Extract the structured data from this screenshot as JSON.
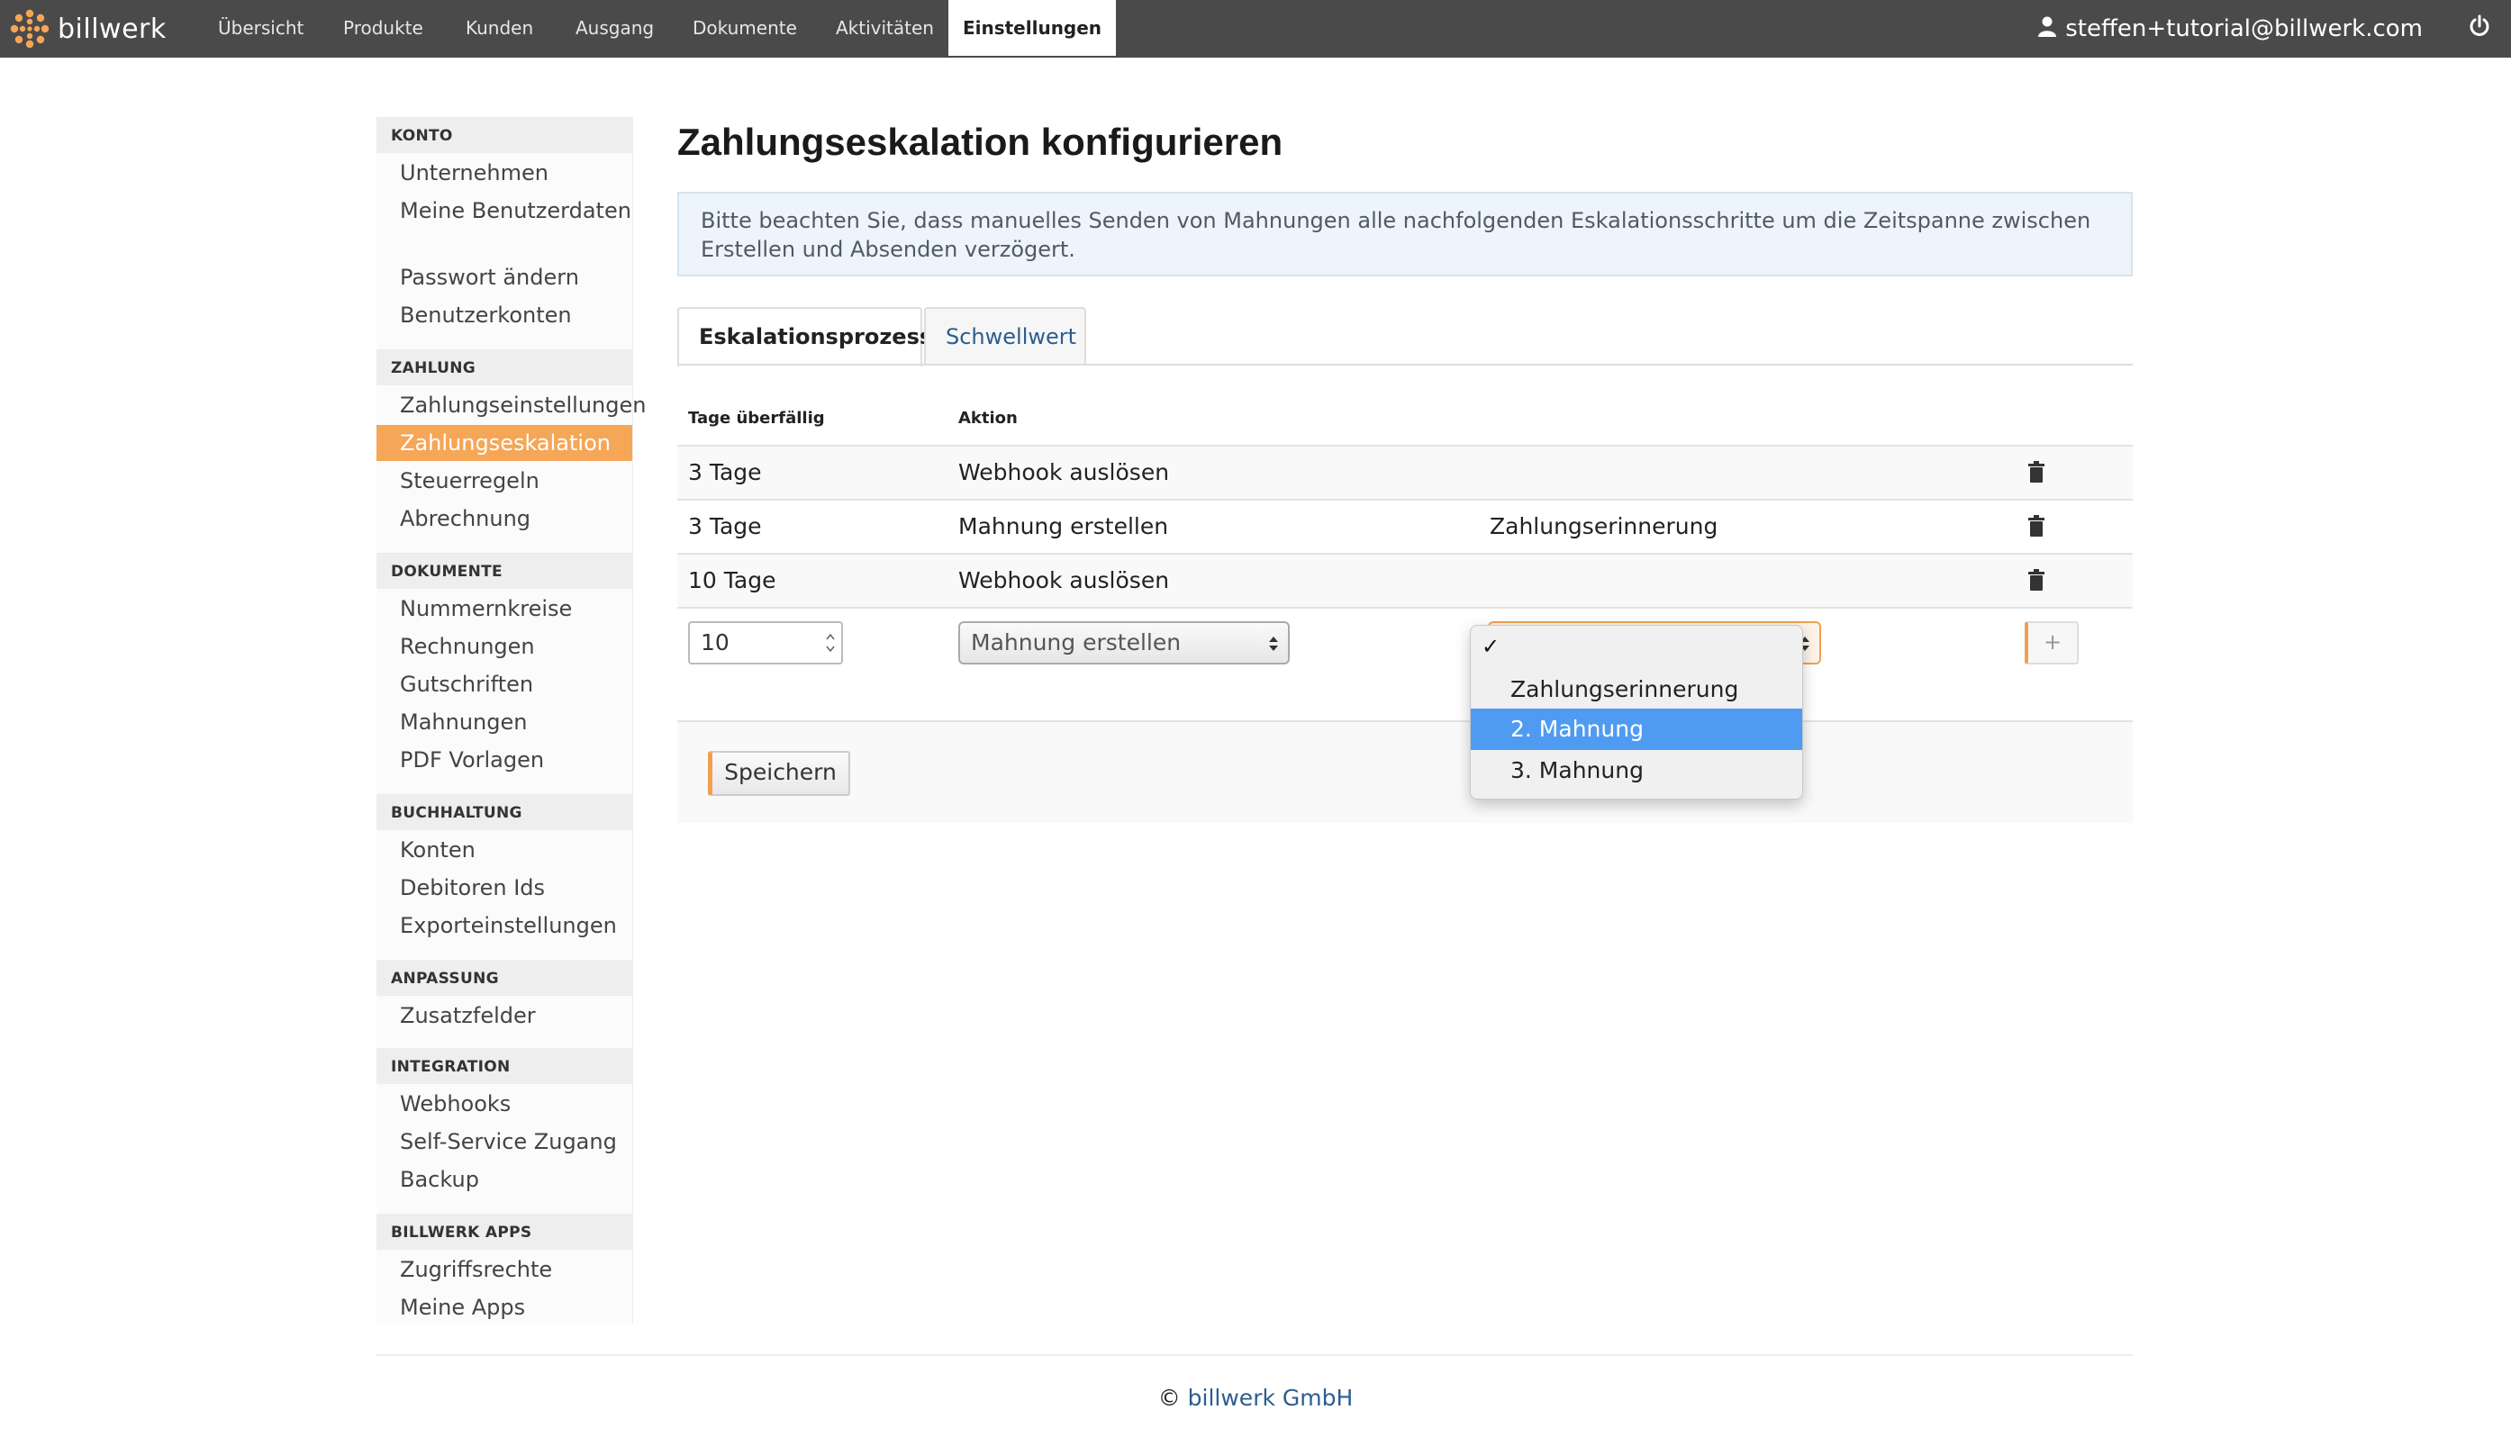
{
  "brand": {
    "name": "billwerk",
    "accent": "#f5a657"
  },
  "nav": {
    "items": [
      {
        "label": "Übersicht"
      },
      {
        "label": "Produkte"
      },
      {
        "label": "Kunden"
      },
      {
        "label": "Ausgang"
      },
      {
        "label": "Dokumente"
      },
      {
        "label": "Aktivitäten"
      },
      {
        "label": "Einstellungen",
        "active": true
      }
    ],
    "user_email": "steffen+tutorial@billwerk.com",
    "user_icon": "user-icon",
    "power_icon": "power-icon"
  },
  "sidebar": {
    "konto": {
      "heading": "KONTO",
      "items": [
        "Unternehmen",
        "Meine Benutzerdaten",
        "Passwort ändern",
        "Benutzerkonten"
      ]
    },
    "zahlung": {
      "heading": "ZAHLUNG",
      "items": [
        "Zahlungseinstellungen",
        "Zahlungseskalation",
        "Steuerregeln",
        "Abrechnung"
      ],
      "active": "Zahlungseskalation"
    },
    "dokumente": {
      "heading": "DOKUMENTE",
      "items": [
        "Nummernkreise",
        "Rechnungen",
        "Gutschriften",
        "Mahnungen",
        "PDF Vorlagen"
      ]
    },
    "buchhaltung": {
      "heading": "BUCHHALTUNG",
      "items": [
        "Konten",
        "Debitoren Ids",
        "Exporteinstellungen"
      ]
    },
    "anpassung": {
      "heading": "ANPASSUNG",
      "items": [
        "Zusatzfelder"
      ]
    },
    "integration": {
      "heading": "INTEGRATION",
      "items": [
        "Webhooks",
        "Self-Service Zugang",
        "Backup"
      ]
    },
    "apps": {
      "heading": "BILLWERK APPS",
      "items": [
        "Zugriffsrechte",
        "Meine Apps"
      ]
    }
  },
  "main": {
    "title": "Zahlungseskalation konfigurieren",
    "info": "Bitte beachten Sie, dass manuelles Senden von Mahnungen alle nachfolgenden Eskalationsschritte um die Zeitspanne zwischen Erstellen und Absenden verzögert.",
    "tabs": [
      {
        "label": "Eskalationsprozess",
        "active": true
      },
      {
        "label": "Schwellwert"
      }
    ],
    "columns": {
      "days": "Tage überfällig",
      "action": "Aktion"
    },
    "rows": [
      {
        "days": "3 Tage",
        "action": "Webhook auslösen",
        "template": ""
      },
      {
        "days": "3 Tage",
        "action": "Mahnung erstellen",
        "template": "Zahlungserinnerung"
      },
      {
        "days": "10 Tage",
        "action": "Webhook auslösen",
        "template": ""
      }
    ],
    "new_row": {
      "days_value": "10",
      "action_selected": "Mahnung erstellen",
      "add_label": "+"
    },
    "template_dropdown": {
      "check_mark": "✓",
      "options": [
        "Zahlungserinnerung",
        "2. Mahnung",
        "3. Mahnung"
      ],
      "highlighted": "2. Mahnung"
    },
    "save_label": "Speichern"
  },
  "footer": {
    "copyright_symbol": "©",
    "company": "billwerk GmbH"
  }
}
